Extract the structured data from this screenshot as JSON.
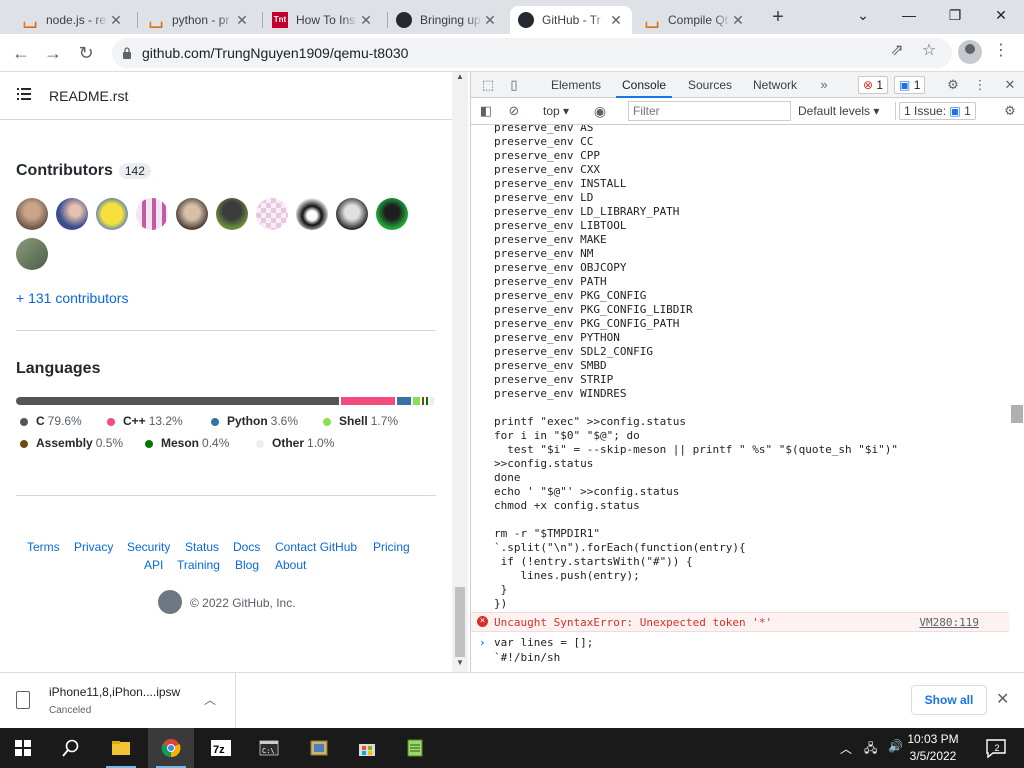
{
  "tabs": [
    {
      "title": "node.js - re",
      "favicon": "stackoverflow-icon"
    },
    {
      "title": "python - pr",
      "favicon": "stackoverflow-icon"
    },
    {
      "title": "How To Ins",
      "favicon": "tnt-icon"
    },
    {
      "title": "Bringing up",
      "favicon": "github-icon"
    },
    {
      "title": "GitHub - Tr",
      "favicon": "github-icon"
    },
    {
      "title": "Compile Qt",
      "favicon": "stackoverflow-icon"
    }
  ],
  "address_bar": {
    "url": "github.com/TrungNguyen1909/qemu-t8030"
  },
  "github": {
    "readme_name": "README.rst",
    "contributors_title": "Contributors",
    "contributors_count": "142",
    "more_contributors": "+ 131 contributors",
    "languages_title": "Languages",
    "languages": [
      {
        "name": "C",
        "pct": "79.6%",
        "color": "#555555"
      },
      {
        "name": "C++",
        "pct": "13.2%",
        "color": "#f34b7d"
      },
      {
        "name": "Python",
        "pct": "3.6%",
        "color": "#3572A5"
      },
      {
        "name": "Shell",
        "pct": "1.7%",
        "color": "#89e051"
      },
      {
        "name": "Assembly",
        "pct": "0.5%",
        "color": "#6E4C13"
      },
      {
        "name": "Meson",
        "pct": "0.4%",
        "color": "#007800"
      },
      {
        "name": "Other",
        "pct": "1.0%",
        "color": "#ededed"
      }
    ],
    "footer_links": [
      "Terms",
      "Privacy",
      "Security",
      "Status",
      "Docs",
      "Contact GitHub",
      "Pricing",
      "API",
      "Training",
      "Blog",
      "About"
    ],
    "copyright": "© 2022 GitHub, Inc."
  },
  "devtools": {
    "tabs": [
      "Elements",
      "Console",
      "Sources",
      "Network"
    ],
    "error_count": "1",
    "info_count": "1",
    "context": "top",
    "filter_placeholder": "Filter",
    "levels": "Default levels",
    "issues_label": "1 Issue:",
    "issues_count": "1",
    "code": "preserve_env AS\npreserve_env CC\npreserve_env CPP\npreserve_env CXX\npreserve_env INSTALL\npreserve_env LD\npreserve_env LD_LIBRARY_PATH\npreserve_env LIBTOOL\npreserve_env MAKE\npreserve_env NM\npreserve_env OBJCOPY\npreserve_env PATH\npreserve_env PKG_CONFIG\npreserve_env PKG_CONFIG_LIBDIR\npreserve_env PKG_CONFIG_PATH\npreserve_env PYTHON\npreserve_env SDL2_CONFIG\npreserve_env SMBD\npreserve_env STRIP\npreserve_env WINDRES\n\nprintf \"exec\" >>config.status\nfor i in \"$0\" \"$@\"; do\n  test \"$i\" = --skip-meson || printf \" %s\" \"$(quote_sh \"$i\")\"\n>>config.status\ndone\necho ' \"$@\"' >>config.status\nchmod +x config.status\n\nrm -r \"$TMPDIR1\"\n`.split(\"\\n\").forEach(function(entry){\n if (!entry.startsWith(\"#\")) {\n    lines.push(entry);\n }\n})",
    "error_message": "Uncaught SyntaxError: Unexpected token '*'",
    "error_source": "VM280:119",
    "prompt_line1": "var lines = [];",
    "prompt_line2": "`#!/bin/sh"
  },
  "download": {
    "filename": "iPhone11,8,iPhon....ipsw",
    "status": "Canceled",
    "show_all": "Show all"
  },
  "taskbar": {
    "time": "10:03 PM",
    "date": "3/5/2022",
    "notifications": "2"
  }
}
